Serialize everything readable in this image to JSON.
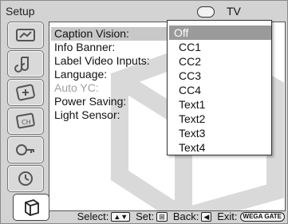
{
  "window": {
    "title": "Setup",
    "input_label": "TV"
  },
  "sidebar": {
    "icons": [
      {
        "name": "picture-icon"
      },
      {
        "name": "sound-icon"
      },
      {
        "name": "screen-icon"
      },
      {
        "name": "channel-icon"
      },
      {
        "name": "parental-lock-icon"
      },
      {
        "name": "timer-icon"
      },
      {
        "name": "setup-icon",
        "active": true
      }
    ]
  },
  "menu": {
    "items": [
      {
        "label": "Caption Vision:",
        "state": "highlighted"
      },
      {
        "label": "Info Banner:",
        "state": "normal"
      },
      {
        "label": "Label Video Inputs:",
        "state": "normal"
      },
      {
        "label": "Language:",
        "state": "normal"
      },
      {
        "label": "Auto YC:",
        "state": "disabled"
      },
      {
        "label": "Power Saving:",
        "state": "normal"
      },
      {
        "label": "Light Sensor:",
        "state": "normal"
      }
    ]
  },
  "dropdown": {
    "selected": "Off",
    "options": [
      "Off",
      "CC1",
      "CC2",
      "CC3",
      "CC4",
      "Text1",
      "Text2",
      "Text3",
      "Text4"
    ]
  },
  "footer": {
    "select_label": "Select:",
    "set_label": "Set:",
    "back_label": "Back:",
    "exit_label": "Exit:",
    "updown_key": "▲▼",
    "set_key": "⊞",
    "back_key": "◀",
    "exit_key": "WEGA GATE"
  }
}
